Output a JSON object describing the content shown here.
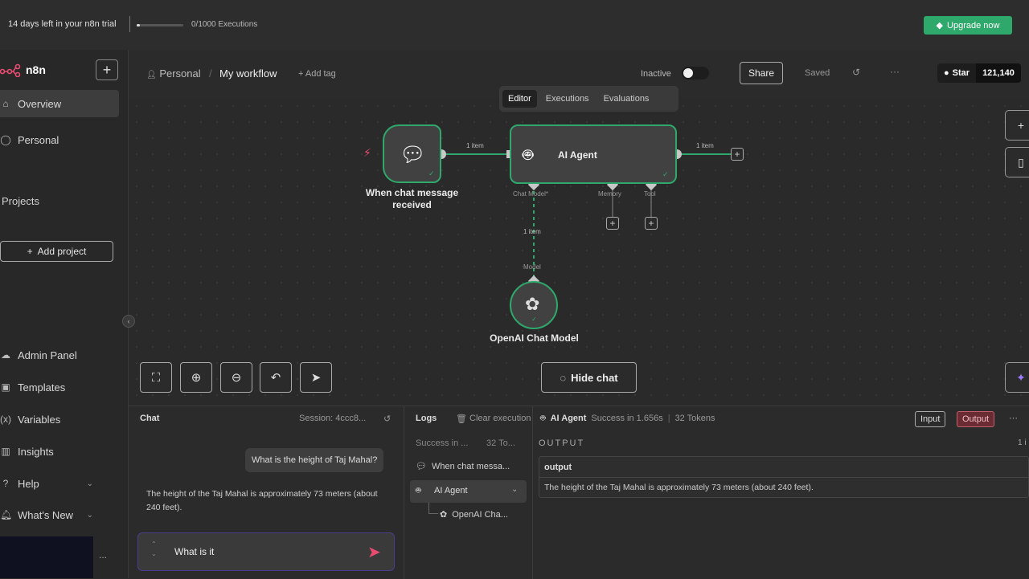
{
  "banner": {
    "trial_text": "14 days left in your n8n trial",
    "executions_text": "0/1000 Executions",
    "upgrade_label": "Upgrade now",
    "upgrade_color": "#2fa86b"
  },
  "sidebar": {
    "logo_text": "n8n",
    "add_icon": "plus-icon",
    "items": [
      {
        "label": "Overview",
        "icon": "home-icon",
        "active": true
      },
      {
        "label": "Personal",
        "icon": "user-icon"
      }
    ],
    "projects_heading": "Projects",
    "add_project_label": "Add project",
    "bottom_items": [
      {
        "label": "Admin Panel",
        "icon": "cloud-icon"
      },
      {
        "label": "Templates",
        "icon": "box-icon"
      },
      {
        "label": "Variables",
        "icon": "variables-icon"
      },
      {
        "label": "Insights",
        "icon": "chart-icon"
      },
      {
        "label": "Help",
        "icon": "help-icon"
      },
      {
        "label": "What's New",
        "icon": "bell-icon"
      }
    ],
    "more_label": "..."
  },
  "header": {
    "breadcrumb_personal": "Personal",
    "breadcrumb_sep": "/",
    "workflow_name": "My workflow",
    "add_tag_label": "+ Add tag",
    "status_label": "Inactive",
    "share_label": "Share",
    "saved_label": "Saved",
    "more_label": "···",
    "star_label": "Star",
    "star_count": "121,140"
  },
  "canvas": {
    "tabs": [
      {
        "label": "Editor",
        "active": true
      },
      {
        "label": "Executions"
      },
      {
        "label": "Evaluations"
      }
    ],
    "nodes": {
      "trigger_label": "When chat message received",
      "agent_label": "AI Agent",
      "model_label": "OpenAI Chat Model"
    },
    "connection_labels": {
      "trigger_to_agent": "1 item",
      "agent_out": "1 item",
      "model_link": "1 item"
    },
    "ports": {
      "chat_model": "Chat Model*",
      "memory": "Memory",
      "tool": "Tool",
      "model": "Model"
    },
    "hide_chat_label": "Hide chat"
  },
  "chat": {
    "title": "Chat",
    "session_label": "Session: 4ccc8...",
    "user_message": "What is the height of Taj Mahal?",
    "bot_message": "The height of the Taj Mahal is approximately 73 meters (about 240 feet).",
    "input_value": "What is it"
  },
  "logs": {
    "title": "Logs",
    "clear_label": "Clear execution",
    "summary_status": "Success in ...",
    "summary_tokens": "32 To...",
    "entries": [
      {
        "label": "When chat messa...",
        "icon": "chat-icon"
      },
      {
        "label": "AI Agent",
        "icon": "robot-icon",
        "selected": true
      },
      {
        "label": "OpenAI Cha...",
        "icon": "openai-icon"
      }
    ]
  },
  "output": {
    "node_label": "AI Agent",
    "status": "Success in 1.656s",
    "tokens": "32 Tokens",
    "input_tab": "Input",
    "output_tab": "Output",
    "heading": "OUTPUT",
    "count": "1 i",
    "field_name": "output",
    "field_value": "The height of the Taj Mahal is approximately 73 meters (about 240 feet)."
  }
}
